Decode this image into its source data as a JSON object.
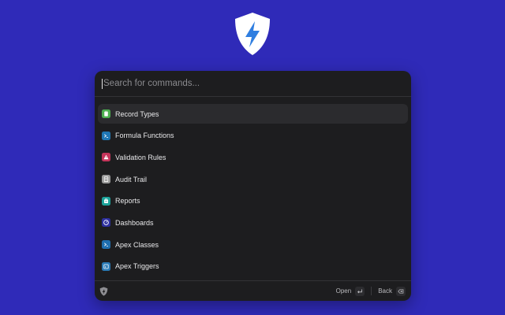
{
  "search": {
    "placeholder": "Search for commands...",
    "value": ""
  },
  "commands": [
    {
      "label": "Record Types",
      "icon": "record-types-icon",
      "color": "#4cae4f"
    },
    {
      "label": "Formula Functions",
      "icon": "formula-functions-icon",
      "color": "#1f77b4"
    },
    {
      "label": "Validation Rules",
      "icon": "validation-rules-icon",
      "color": "#c4345a"
    },
    {
      "label": "Audit Trail",
      "icon": "audit-trail-icon",
      "color": "#9a9a9a"
    },
    {
      "label": "Reports",
      "icon": "reports-icon",
      "color": "#1ca29a"
    },
    {
      "label": "Dashboards",
      "icon": "dashboards-icon",
      "color": "#2d2f9e"
    },
    {
      "label": "Apex Classes",
      "icon": "apex-classes-icon",
      "color": "#1f6fb0"
    },
    {
      "label": "Apex Triggers",
      "icon": "apex-triggers-icon",
      "color": "#2a7ab5"
    }
  ],
  "footer": {
    "open_label": "Open",
    "back_label": "Back"
  },
  "colors": {
    "background": "#2f2ab8",
    "panel": "#1d1d1f",
    "selected": "#2b2b2e",
    "logo": "#2f7ee0"
  }
}
